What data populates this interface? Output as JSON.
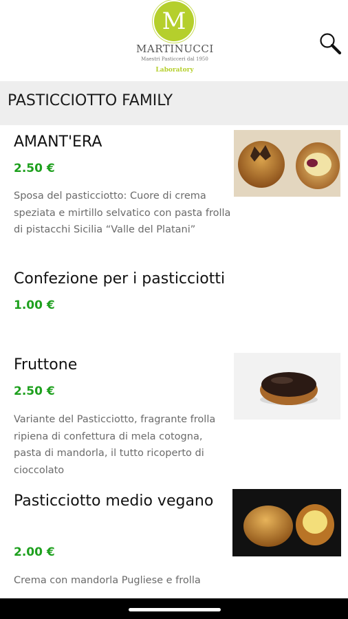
{
  "header": {
    "logo_letter": "M",
    "brand": "MARTINUCCI",
    "tagline": "Maestri Pasticceri dal 1950",
    "sub": "Laboratory",
    "brand_color": "#b5cf2c",
    "search_icon": "search-icon"
  },
  "category": {
    "title": "PASTICCIOTTO FAMILY",
    "background": "#eeeeee"
  },
  "price_color": "#1ea01e",
  "products": [
    {
      "name": "AMANT'ERA",
      "price": "2.50 €",
      "description": "Sposa del pasticciotto: Cuore di crema speziata e mirtillo selvatico con pasta frolla di pistacchi Sicilia “Valle del Platani”"
    },
    {
      "name": "Confezione per i pasticciotti",
      "price": "1.00 €"
    },
    {
      "name": "Fruttone",
      "price": "2.50 €",
      "description": "Variante del Pasticciotto, fragrante frolla ripiena di confettura di mela cotogna, pasta di mandorla, il tutto ricoperto di cioccolato"
    },
    {
      "name": "Pasticciotto medio vegano",
      "price": "2.00 €",
      "description": "Crema con mandorla Pugliese e frolla"
    }
  ]
}
